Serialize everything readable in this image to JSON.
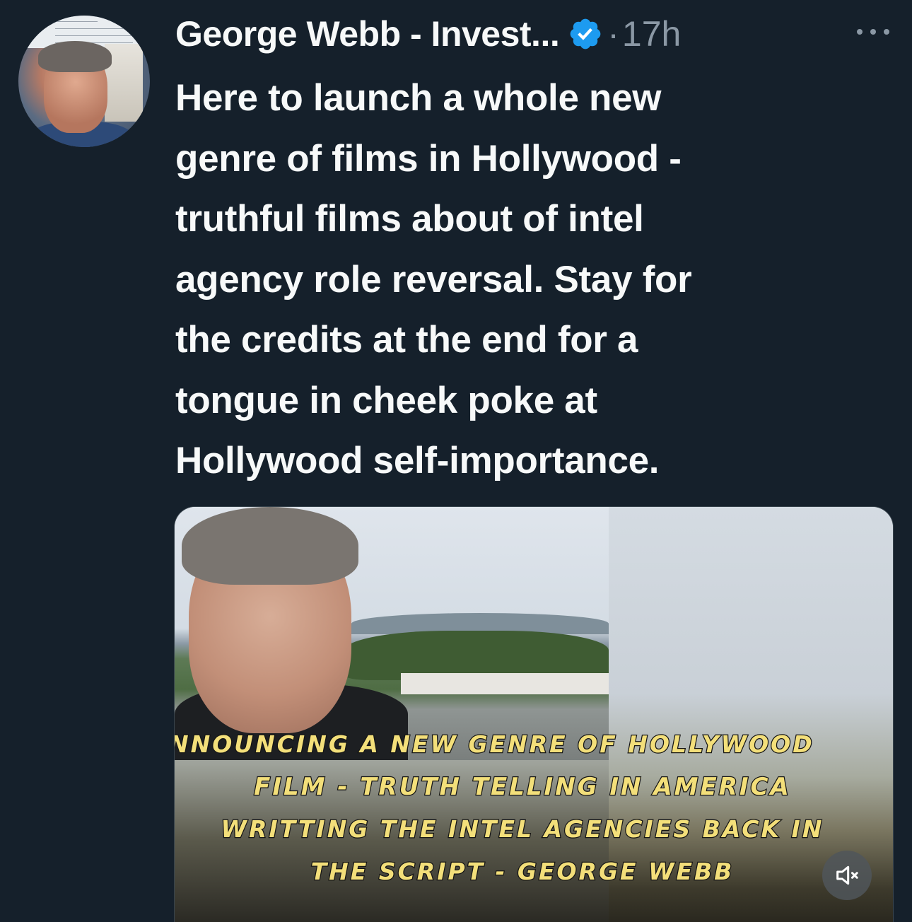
{
  "tweet": {
    "author_name": "George Webb - Invest...",
    "separator": "·",
    "timestamp": "17h",
    "text": "Here to launch a whole new\ngenre of films in Hollywood -\ntruthful films about of intel\nagency role reversal. Stay for\nthe credits at the end for a\ntongue in cheek poke at\nHollywood self-importance.",
    "icons": {
      "verified": "verified-badge-icon",
      "more": "more-icon",
      "mute": "volume-muted-icon"
    }
  },
  "media": {
    "caption_lines": [
      "nnouncing a new genre of hollywood",
      "Film - Truth telling In America",
      "Writting the intel agencies back in",
      "the script - George Webb"
    ]
  },
  "colors": {
    "background": "#15202b",
    "text_primary": "#f7f9f9",
    "text_secondary": "#8b98a5",
    "verified_blue": "#1d9bf0",
    "caption_yellow": "#f3df7a"
  }
}
